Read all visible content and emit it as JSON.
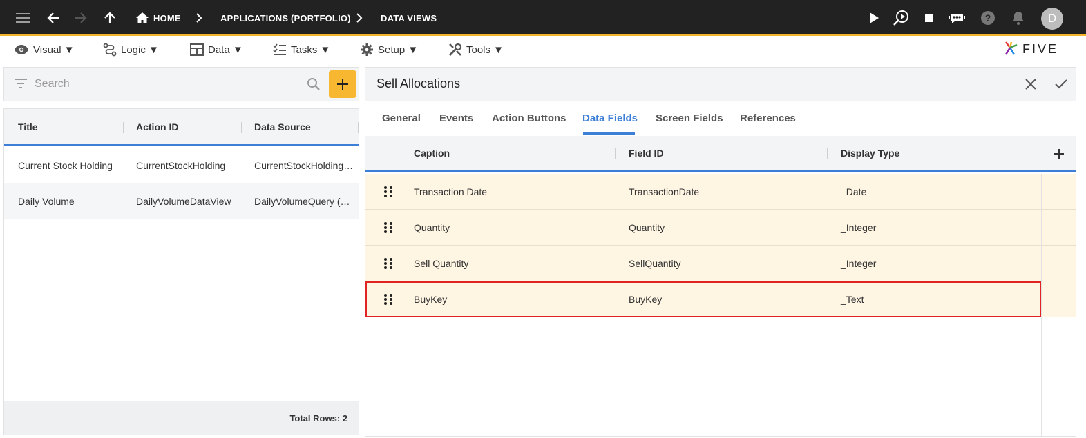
{
  "topbar": {
    "breadcrumb": [
      "HOME",
      "APPLICATIONS (PORTFOLIO)",
      "DATA VIEWS"
    ],
    "avatar_initial": "D",
    "accent_color": "#f4b52a"
  },
  "menu": {
    "items": [
      {
        "label": "Visual ▼",
        "icon": "eye-icon"
      },
      {
        "label": "Logic ▼",
        "icon": "logic-icon"
      },
      {
        "label": "Data ▼",
        "icon": "table-icon"
      },
      {
        "label": "Tasks ▼",
        "icon": "tasks-icon"
      },
      {
        "label": "Setup ▼",
        "icon": "gear-icon"
      },
      {
        "label": "Tools ▼",
        "icon": "tools-icon"
      }
    ],
    "logo_text": "FIVE"
  },
  "search": {
    "placeholder": "Search",
    "value": ""
  },
  "list": {
    "columns": [
      "Title",
      "Action ID",
      "Data Source"
    ],
    "rows": [
      [
        "Current Stock Holding",
        "CurrentStockHolding",
        "CurrentStockHolding…"
      ],
      [
        "Daily Volume",
        "DailyVolumeDataView",
        "DailyVolumeQuery (…"
      ]
    ],
    "total_rows": "Total Rows: 2"
  },
  "detail": {
    "title": "Sell Allocations",
    "tabs": [
      "General",
      "Events",
      "Action Buttons",
      "Data Fields",
      "Screen Fields",
      "References"
    ],
    "active_tab": "Data Fields",
    "grid_columns": [
      "Caption",
      "Field ID",
      "Display Type"
    ],
    "grid_rows": [
      [
        "Transaction Date",
        "TransactionDate",
        "_Date"
      ],
      [
        "Quantity",
        "Quantity",
        "_Integer"
      ],
      [
        "Sell Quantity",
        "SellQuantity",
        "_Integer"
      ],
      [
        "BuyKey",
        "BuyKey",
        "_Text"
      ]
    ],
    "selected_row": 3,
    "row_color": "#fff5e3",
    "highlight_color": "#e02424",
    "tab_accent": "#3d7fd6"
  }
}
